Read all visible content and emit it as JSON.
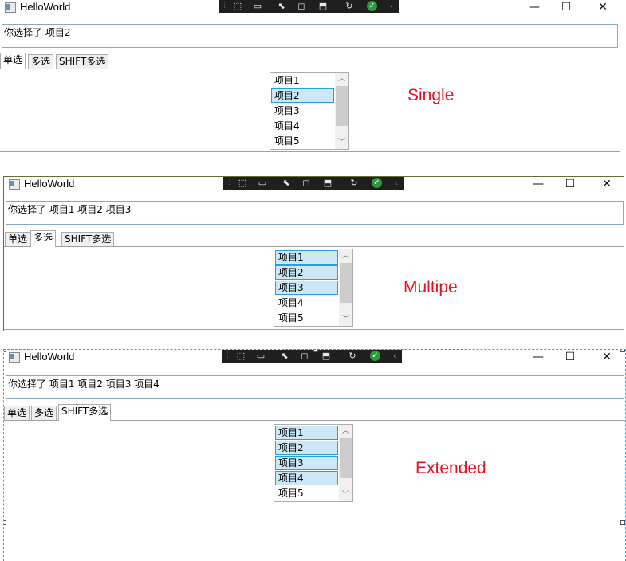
{
  "windows": [
    {
      "title": "HelloWorld",
      "selected_text": "你选择了 项目2",
      "tabs": [
        "单选",
        "多选",
        "SHIFT多选"
      ],
      "active_tab": 0,
      "list_items": [
        "项目1",
        "项目2",
        "项目3",
        "项目4",
        "项目5"
      ],
      "selected_items": [
        1
      ],
      "focused_item": 1,
      "mode_label": "Single"
    },
    {
      "title": "HelloWorld",
      "selected_text": "你选择了 项目1 项目2 项目3",
      "tabs": [
        "单选",
        "多选",
        "SHIFT多选"
      ],
      "active_tab": 1,
      "list_items": [
        "项目1",
        "项目2",
        "项目3",
        "项目4",
        "项目5"
      ],
      "selected_items": [
        0,
        1,
        2
      ],
      "focused_item": 2,
      "mode_label": "Multipe"
    },
    {
      "title": "HelloWorld",
      "selected_text": "你选择了 项目1 项目2 项目3 项目4",
      "tabs": [
        "单选",
        "多选",
        "SHIFT多选"
      ],
      "active_tab": 2,
      "list_items": [
        "项目1",
        "项目2",
        "项目3",
        "项目4",
        "项目5"
      ],
      "selected_items": [
        0,
        1,
        2,
        3
      ],
      "focused_item": 3,
      "mode_label": "Extended"
    }
  ],
  "toolbar_icons": [
    "grip-icon",
    "select-element-icon",
    "video-icon",
    "pointer-icon",
    "layout-adorner-icon",
    "track-focus-icon",
    "hot-reload-icon",
    "binding-ok-icon",
    "collapse-icon"
  ],
  "window_controls": {
    "minimize": "—",
    "maximize": "☐",
    "close": "✕"
  },
  "colors": {
    "mode_label": "#e81123",
    "selection_bg": "#cce8f7",
    "selection_border": "#26a0da",
    "toolbar_bg": "#1f1f1f"
  }
}
